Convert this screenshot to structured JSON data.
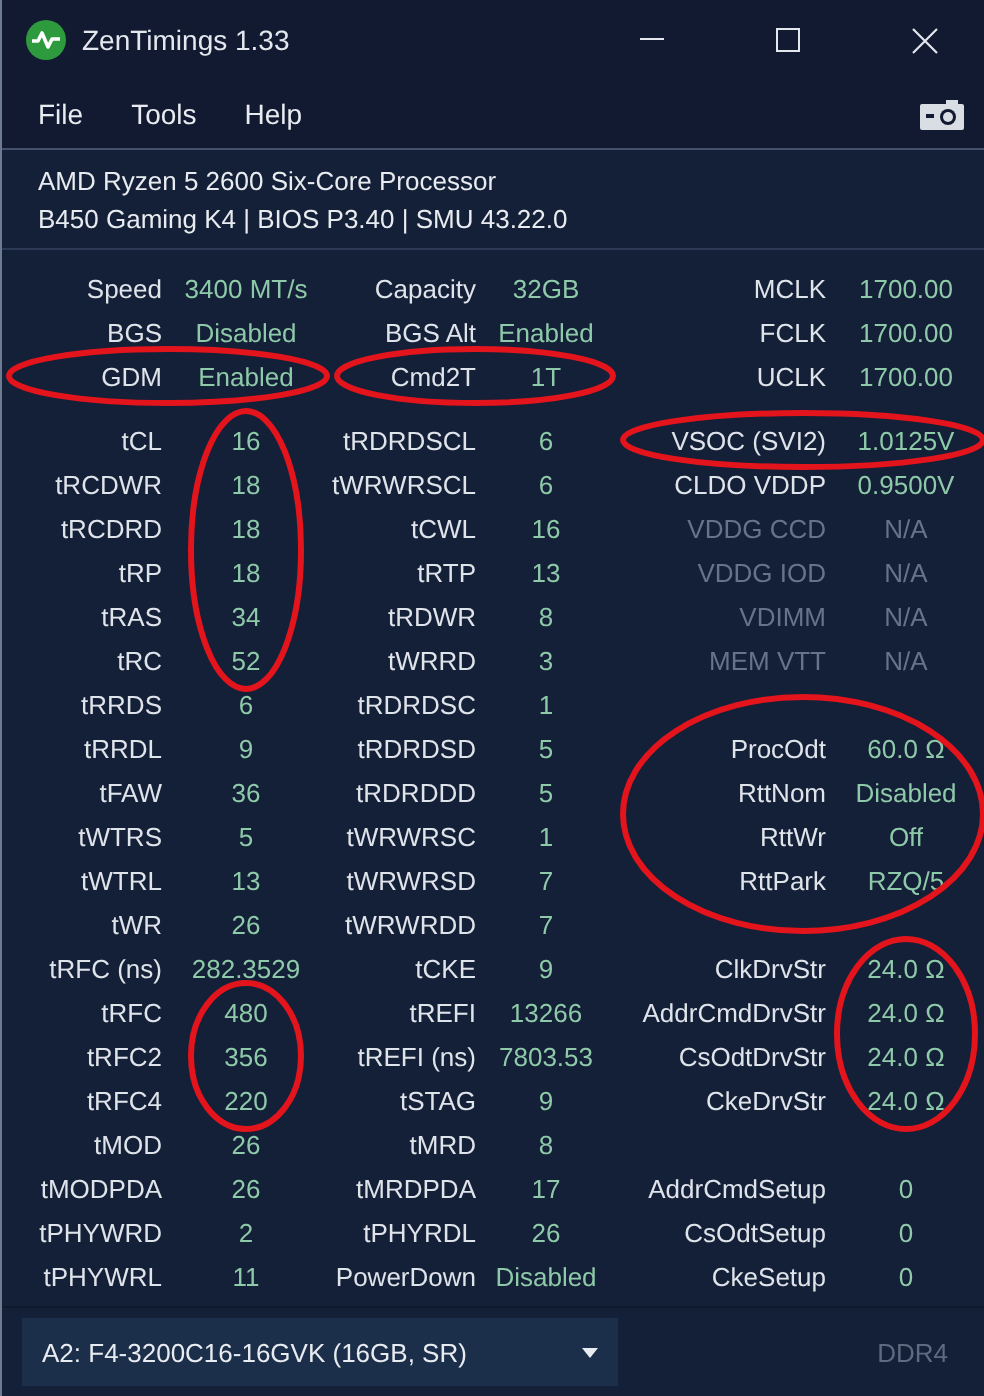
{
  "window": {
    "title": "ZenTimings 1.33"
  },
  "menu": [
    "File",
    "Tools",
    "Help"
  ],
  "system": {
    "cpu": "AMD Ryzen 5 2600 Six-Core Processor",
    "board": "B450 Gaming K4 | BIOS P3.40 | SMU 43.22.0"
  },
  "summary": {
    "columns": [
      [
        {
          "kind": "entry",
          "label": "Speed",
          "value": "3400 MT/s",
          "dim": false,
          "circled": false
        },
        {
          "kind": "entry",
          "label": "BGS",
          "value": "Disabled",
          "dim": false,
          "circled": false
        },
        {
          "kind": "entry",
          "label": "GDM",
          "value": "Enabled",
          "dim": false,
          "circled": true,
          "label_circled": true
        }
      ],
      [
        {
          "kind": "entry",
          "label": "Capacity",
          "value": "32GB",
          "dim": false,
          "circled": false
        },
        {
          "kind": "entry",
          "label": "BGS Alt",
          "value": "Enabled",
          "dim": false,
          "circled": false
        },
        {
          "kind": "entry",
          "label": "Cmd2T",
          "value": "1T",
          "dim": false,
          "circled": true,
          "label_circled": true
        }
      ],
      [
        {
          "kind": "entry",
          "label": "MCLK",
          "value": "1700.00",
          "dim": false,
          "circled": false
        },
        {
          "kind": "entry",
          "label": "FCLK",
          "value": "1700.00",
          "dim": false,
          "circled": false
        },
        {
          "kind": "entry",
          "label": "UCLK",
          "value": "1700.00",
          "dim": false,
          "circled": false
        }
      ]
    ]
  },
  "timings": {
    "columns": [
      [
        {
          "kind": "entry",
          "label": "tCL",
          "value": "16",
          "dim": false,
          "circled": true,
          "label_circled": false
        },
        {
          "kind": "entry",
          "label": "tRCDWR",
          "value": "18",
          "dim": false,
          "circled": true,
          "label_circled": false
        },
        {
          "kind": "entry",
          "label": "tRCDRD",
          "value": "18",
          "dim": false,
          "circled": true,
          "label_circled": false
        },
        {
          "kind": "entry",
          "label": "tRP",
          "value": "18",
          "dim": false,
          "circled": true,
          "label_circled": false
        },
        {
          "kind": "entry",
          "label": "tRAS",
          "value": "34",
          "dim": false,
          "circled": true,
          "label_circled": false
        },
        {
          "kind": "entry",
          "label": "tRC",
          "value": "52",
          "dim": false,
          "circled": true,
          "label_circled": false
        },
        {
          "kind": "entry",
          "label": "tRRDS",
          "value": "6",
          "dim": false,
          "circled": false
        },
        {
          "kind": "entry",
          "label": "tRRDL",
          "value": "9",
          "dim": false,
          "circled": false
        },
        {
          "kind": "entry",
          "label": "tFAW",
          "value": "36",
          "dim": false,
          "circled": false
        },
        {
          "kind": "entry",
          "label": "tWTRS",
          "value": "5",
          "dim": false,
          "circled": false
        },
        {
          "kind": "entry",
          "label": "tWTRL",
          "value": "13",
          "dim": false,
          "circled": false
        },
        {
          "kind": "entry",
          "label": "tWR",
          "value": "26",
          "dim": false,
          "circled": false
        },
        {
          "kind": "entry",
          "label": "tRFC (ns)",
          "value": "282.3529",
          "dim": false,
          "circled": false
        },
        {
          "kind": "entry",
          "label": "tRFC",
          "value": "480",
          "dim": false,
          "circled": true,
          "label_circled": false
        },
        {
          "kind": "entry",
          "label": "tRFC2",
          "value": "356",
          "dim": false,
          "circled": true,
          "label_circled": false
        },
        {
          "kind": "entry",
          "label": "tRFC4",
          "value": "220",
          "dim": false,
          "circled": true,
          "label_circled": false
        },
        {
          "kind": "entry",
          "label": "tMOD",
          "value": "26",
          "dim": false,
          "circled": false
        },
        {
          "kind": "entry",
          "label": "tMODPDA",
          "value": "26",
          "dim": false,
          "circled": false
        },
        {
          "kind": "entry",
          "label": "tPHYWRD",
          "value": "2",
          "dim": false,
          "circled": false
        },
        {
          "kind": "entry",
          "label": "tPHYWRL",
          "value": "11",
          "dim": false,
          "circled": false
        }
      ],
      [
        {
          "kind": "entry",
          "label": "tRDRDSCL",
          "value": "6",
          "dim": false,
          "circled": false
        },
        {
          "kind": "entry",
          "label": "tWRWRSCL",
          "value": "6",
          "dim": false,
          "circled": false
        },
        {
          "kind": "entry",
          "label": "tCWL",
          "value": "16",
          "dim": false,
          "circled": false
        },
        {
          "kind": "entry",
          "label": "tRTP",
          "value": "13",
          "dim": false,
          "circled": false
        },
        {
          "kind": "entry",
          "label": "tRDWR",
          "value": "8",
          "dim": false,
          "circled": false
        },
        {
          "kind": "entry",
          "label": "tWRRD",
          "value": "3",
          "dim": false,
          "circled": false
        },
        {
          "kind": "entry",
          "label": "tRDRDSC",
          "value": "1",
          "dim": false,
          "circled": false
        },
        {
          "kind": "entry",
          "label": "tRDRDSD",
          "value": "5",
          "dim": false,
          "circled": false
        },
        {
          "kind": "entry",
          "label": "tRDRDDD",
          "value": "5",
          "dim": false,
          "circled": false
        },
        {
          "kind": "entry",
          "label": "tWRWRSC",
          "value": "1",
          "dim": false,
          "circled": false
        },
        {
          "kind": "entry",
          "label": "tWRWRSD",
          "value": "7",
          "dim": false,
          "circled": false
        },
        {
          "kind": "entry",
          "label": "tWRWRDD",
          "value": "7",
          "dim": false,
          "circled": false
        },
        {
          "kind": "entry",
          "label": "tCKE",
          "value": "9",
          "dim": false,
          "circled": false
        },
        {
          "kind": "entry",
          "label": "tREFI",
          "value": "13266",
          "dim": false,
          "circled": false
        },
        {
          "kind": "entry",
          "label": "tREFI (ns)",
          "value": "7803.53",
          "dim": false,
          "circled": false
        },
        {
          "kind": "entry",
          "label": "tSTAG",
          "value": "9",
          "dim": false,
          "circled": false
        },
        {
          "kind": "entry",
          "label": "tMRD",
          "value": "8",
          "dim": false,
          "circled": false
        },
        {
          "kind": "entry",
          "label": "tMRDPDA",
          "value": "17",
          "dim": false,
          "circled": false
        },
        {
          "kind": "entry",
          "label": "tPHYRDL",
          "value": "26",
          "dim": false,
          "circled": false
        },
        {
          "kind": "entry",
          "label": "PowerDown",
          "value": "Disabled",
          "dim": false,
          "circled": false
        }
      ],
      [
        {
          "kind": "entry",
          "label": "VSOC (SVI2)",
          "value": "1.0125V",
          "dim": false,
          "circled": true,
          "label_circled": true
        },
        {
          "kind": "entry",
          "label": "CLDO VDDP",
          "value": "0.9500V",
          "dim": false,
          "circled": false
        },
        {
          "kind": "entry",
          "label": "VDDG CCD",
          "value": "N/A",
          "dim": true,
          "circled": false
        },
        {
          "kind": "entry",
          "label": "VDDG IOD",
          "value": "N/A",
          "dim": true,
          "circled": false
        },
        {
          "kind": "entry",
          "label": "VDIMM",
          "value": "N/A",
          "dim": true,
          "circled": false
        },
        {
          "kind": "entry",
          "label": "MEM VTT",
          "value": "N/A",
          "dim": true,
          "circled": false
        },
        {
          "kind": "blank"
        },
        {
          "kind": "entry",
          "label": "ProcOdt",
          "value": "60.0 Ω",
          "dim": false,
          "circled": true,
          "label_circled": true
        },
        {
          "kind": "entry",
          "label": "RttNom",
          "value": "Disabled",
          "dim": false,
          "circled": true,
          "label_circled": true
        },
        {
          "kind": "entry",
          "label": "RttWr",
          "value": "Off",
          "dim": false,
          "circled": true,
          "label_circled": true
        },
        {
          "kind": "entry",
          "label": "RttPark",
          "value": "RZQ/5",
          "dim": false,
          "circled": true,
          "label_circled": true
        },
        {
          "kind": "blank"
        },
        {
          "kind": "entry",
          "label": "ClkDrvStr",
          "value": "24.0 Ω",
          "dim": false,
          "circled": true,
          "label_circled": false
        },
        {
          "kind": "entry",
          "label": "AddrCmdDrvStr",
          "value": "24.0 Ω",
          "dim": false,
          "circled": true,
          "label_circled": false
        },
        {
          "kind": "entry",
          "label": "CsOdtDrvStr",
          "value": "24.0 Ω",
          "dim": false,
          "circled": true,
          "label_circled": false
        },
        {
          "kind": "entry",
          "label": "CkeDrvStr",
          "value": "24.0 Ω",
          "dim": false,
          "circled": true,
          "label_circled": false
        },
        {
          "kind": "blank"
        },
        {
          "kind": "entry",
          "label": "AddrCmdSetup",
          "value": "0",
          "dim": false,
          "circled": false
        },
        {
          "kind": "entry",
          "label": "CsOdtSetup",
          "value": "0",
          "dim": false,
          "circled": false
        },
        {
          "kind": "entry",
          "label": "CkeSetup",
          "value": "0",
          "dim": false,
          "circled": false
        }
      ]
    ]
  },
  "footer": {
    "module": "A2: F4-3200C16-16GVK (16GB, SR)",
    "memory_type": "DDR4"
  }
}
